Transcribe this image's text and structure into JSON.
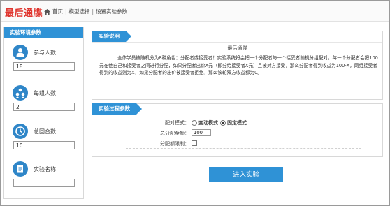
{
  "header": {
    "brand": "最后通牒",
    "breadcrumb": [
      "首页",
      "模型选择",
      "设置实验参数"
    ],
    "separator": "|"
  },
  "left_panel": {
    "title": "实验环境参数",
    "params": [
      {
        "label": "参与人数",
        "value": "18",
        "icon": "people-icon"
      },
      {
        "label": "每组人数",
        "value": "2",
        "icon": "group-icon"
      },
      {
        "label": "总回合数",
        "value": "10",
        "icon": "clock-icon"
      },
      {
        "label": "实验名称",
        "value": "",
        "icon": "document-icon"
      }
    ]
  },
  "description": {
    "tab": "实验说明",
    "title": "最后通牒",
    "body": "全体学员被随机分为8种角色：分配者或接受者！实验系统将会把一个分配者与一个接受者随机分组配对。每一个分配者会把100元在他自己和接受者之间进行分配，如果分配者出价X元（即分给接受者X元）且被对方接受，那么分配者得到收益为100-X，网组接受者得到的收益则为X，如果分配者的出价被接受者拒绝，那么该轮双方收益都为0。"
  },
  "process": {
    "tab": "实验过程参数",
    "mode_label": "配对模式：",
    "modes": [
      {
        "label": "变动模式",
        "selected": false
      },
      {
        "label": "固定模式",
        "selected": true
      }
    ],
    "amount_label": "总分配金额：",
    "amount_value": "100",
    "limit_label": "分配额限制："
  },
  "enter_button": "进入实验",
  "colors": {
    "accent": "#2f92d6",
    "brand": "#e0362f",
    "icon_bg": "#2f86c8"
  }
}
